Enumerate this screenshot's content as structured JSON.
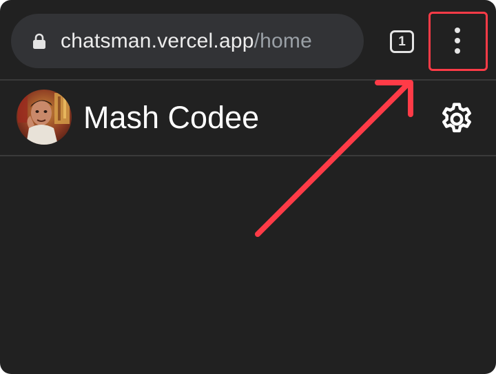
{
  "browser": {
    "url_host": "chatsman.vercel.app",
    "url_path": "/home",
    "tab_count": "1",
    "icons": {
      "lock": "lock-icon",
      "menu": "more-vert-icon",
      "tabs": "tab-switcher-icon"
    }
  },
  "header": {
    "user_name": "Mash Codee",
    "avatar": "user-avatar",
    "settings_icon": "gear-icon"
  },
  "annotation": {
    "highlight_color": "#ff3b47",
    "target": "browser-menu-button"
  },
  "colors": {
    "background": "#212121",
    "url_bar": "#323336",
    "text_primary": "#ffffff",
    "text_muted": "#9aa0a6"
  }
}
